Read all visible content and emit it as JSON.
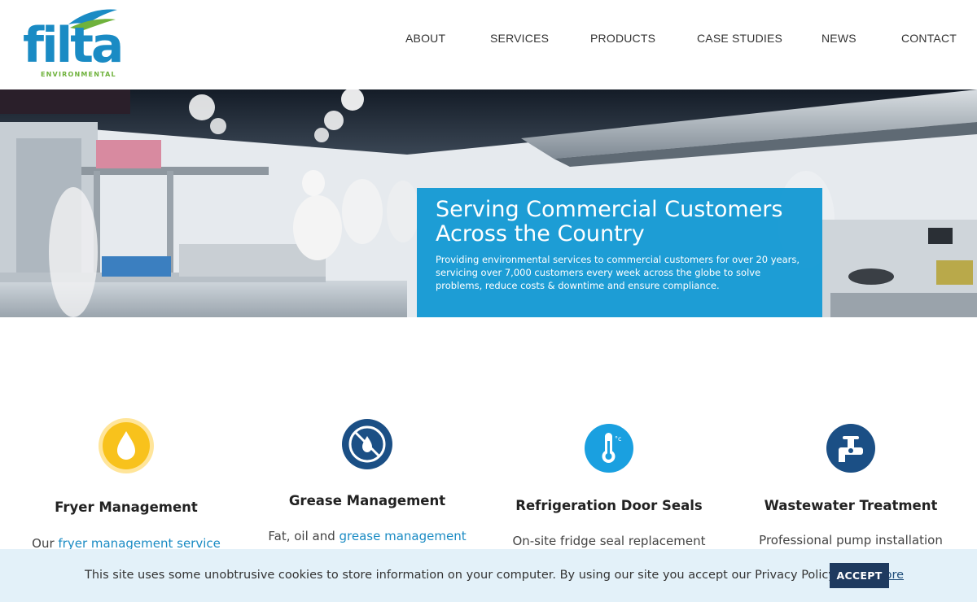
{
  "brand": {
    "logo_text": "filta",
    "logo_sub": "ENVIRONMENTAL",
    "primary_color": "#1a8bc4",
    "accent_color": "#6fb23c"
  },
  "nav": {
    "about": "ABOUT",
    "services": "SERVICES",
    "products": "PRODUCTS",
    "case_studies": "CASE STUDIES",
    "news": "NEWS",
    "contact": "CONTACT"
  },
  "hero": {
    "title_line1": "Serving Commercial Customers",
    "title_line2": "Across the Country",
    "text": "Providing environmental services to commercial customers for over 20 years, servicing over 7,000 customers every week across the globe to solve problems, reduce costs & downtime and ensure compliance.",
    "box_color": "#0c96d2"
  },
  "services": [
    {
      "title": "Fryer Management",
      "desc_prefix": "Our ",
      "desc_link": "fryer management service",
      "desc_suffix": "",
      "icon": "oil-drop-icon"
    },
    {
      "title": "Grease Management",
      "desc_prefix": "Fat, oil and ",
      "desc_link": "grease management",
      "desc_suffix": "",
      "icon": "no-grease-icon"
    },
    {
      "title": "Refrigeration Door Seals",
      "desc_prefix": "On-site fridge seal replacement",
      "desc_link": "",
      "desc_suffix": "",
      "icon": "thermometer-icon"
    },
    {
      "title": "Wastewater Treatment",
      "desc_prefix": "Professional pump installation",
      "desc_link": "",
      "desc_suffix": "",
      "icon": "valve-pipe-icon"
    }
  ],
  "cookie": {
    "text": "This site uses some unobtrusive cookies to store information on your computer. By using our site you accept our Privacy Policy.",
    "read_more": "Read More",
    "accept": "ACCEPT"
  }
}
